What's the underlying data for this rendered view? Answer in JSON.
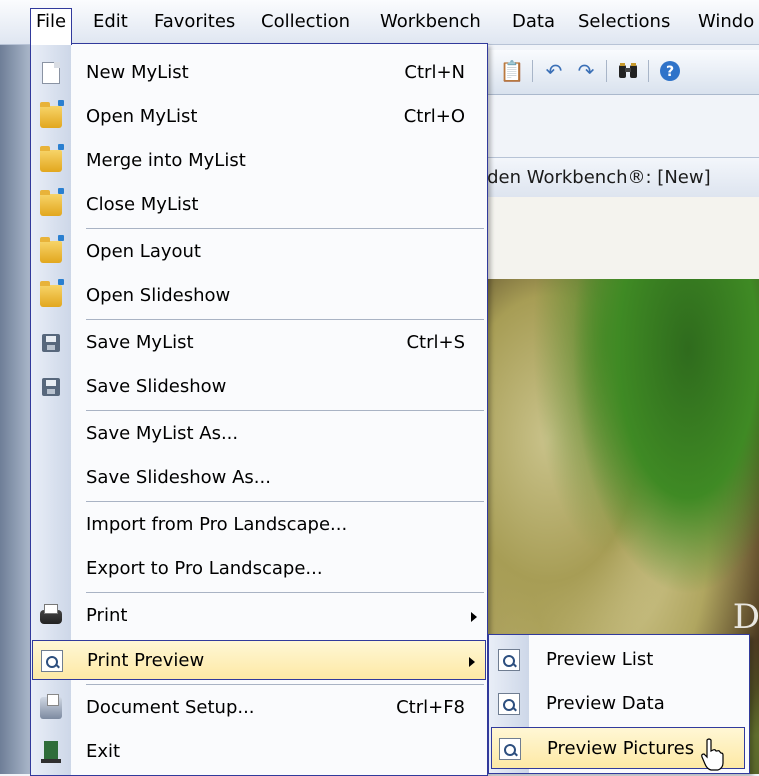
{
  "menubar": {
    "items": [
      {
        "label": "File",
        "name": "menu-file"
      },
      {
        "label": "Edit",
        "name": "menu-edit"
      },
      {
        "label": "Favorites",
        "name": "menu-favorites"
      },
      {
        "label": "Collection",
        "name": "menu-collection"
      },
      {
        "label": "Workbench",
        "name": "menu-workbench"
      },
      {
        "label": "Data",
        "name": "menu-data"
      },
      {
        "label": "Selections",
        "name": "menu-selections"
      },
      {
        "label": "Windo",
        "name": "menu-window"
      }
    ]
  },
  "document": {
    "title": "rden Workbench®: [New]"
  },
  "file_menu": {
    "items": [
      {
        "label": "New MyList",
        "shortcut": "Ctrl+N",
        "icon": "new-page-icon"
      },
      {
        "label": "Open MyList",
        "shortcut": "Ctrl+O",
        "icon": "open-folder-icon"
      },
      {
        "label": "Merge into MyList",
        "shortcut": "",
        "icon": "open-folder-icon"
      },
      {
        "label": "Close MyList",
        "shortcut": "",
        "icon": "close-folder-icon"
      },
      {
        "label": "Open Layout",
        "shortcut": "",
        "icon": "open-folder-icon"
      },
      {
        "label": "Open Slideshow",
        "shortcut": "",
        "icon": "open-folder-icon"
      },
      {
        "label": "Save MyList",
        "shortcut": "Ctrl+S",
        "icon": "disk-icon"
      },
      {
        "label": "Save Slideshow",
        "shortcut": "",
        "icon": "disk-icon"
      },
      {
        "label": "Save MyList As...",
        "shortcut": ""
      },
      {
        "label": "Save Slideshow As...",
        "shortcut": ""
      },
      {
        "label": "Import from Pro Landscape...",
        "shortcut": ""
      },
      {
        "label": "Export to Pro Landscape...",
        "shortcut": ""
      },
      {
        "label": "Print",
        "shortcut": "",
        "icon": "printer-icon",
        "has_submenu": true
      },
      {
        "label": "Print Preview",
        "shortcut": "",
        "icon": "print-preview-icon",
        "has_submenu": true,
        "highlighted": true
      },
      {
        "label": "Document Setup...",
        "shortcut": "Ctrl+F8",
        "icon": "document-setup-icon"
      },
      {
        "label": "Exit",
        "shortcut": "",
        "icon": "exit-icon"
      }
    ]
  },
  "preview_submenu": {
    "items": [
      {
        "label": "Preview List",
        "icon": "print-preview-icon"
      },
      {
        "label": "Preview Data",
        "icon": "print-preview-icon"
      },
      {
        "label": "Preview Pictures",
        "icon": "print-preview-icon",
        "highlighted": true
      }
    ]
  },
  "photo": {
    "overlay_text": "D"
  },
  "toolbar": {
    "icons": [
      "paste-icon",
      "undo-icon",
      "redo-icon",
      "binoculars-icon",
      "help-icon"
    ]
  }
}
